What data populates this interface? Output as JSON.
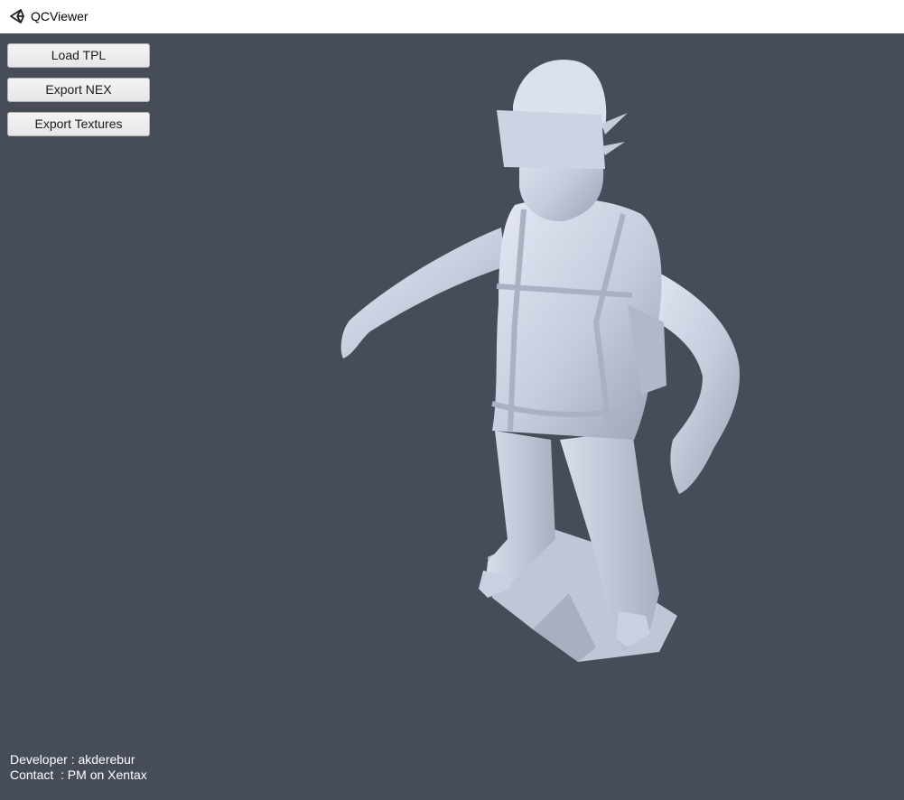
{
  "window": {
    "title": "QCViewer",
    "icon": "unity-logo-icon"
  },
  "toolbar": {
    "load_tpl_label": "Load TPL",
    "export_nex_label": "Export NEX",
    "export_textures_label": "Export Textures"
  },
  "viewport": {
    "background_color": "#474d58",
    "model_color": "#c5ccdc"
  },
  "credits": {
    "developer": "Developer : akderebur",
    "contact": "Contact  : PM on Xentax"
  }
}
